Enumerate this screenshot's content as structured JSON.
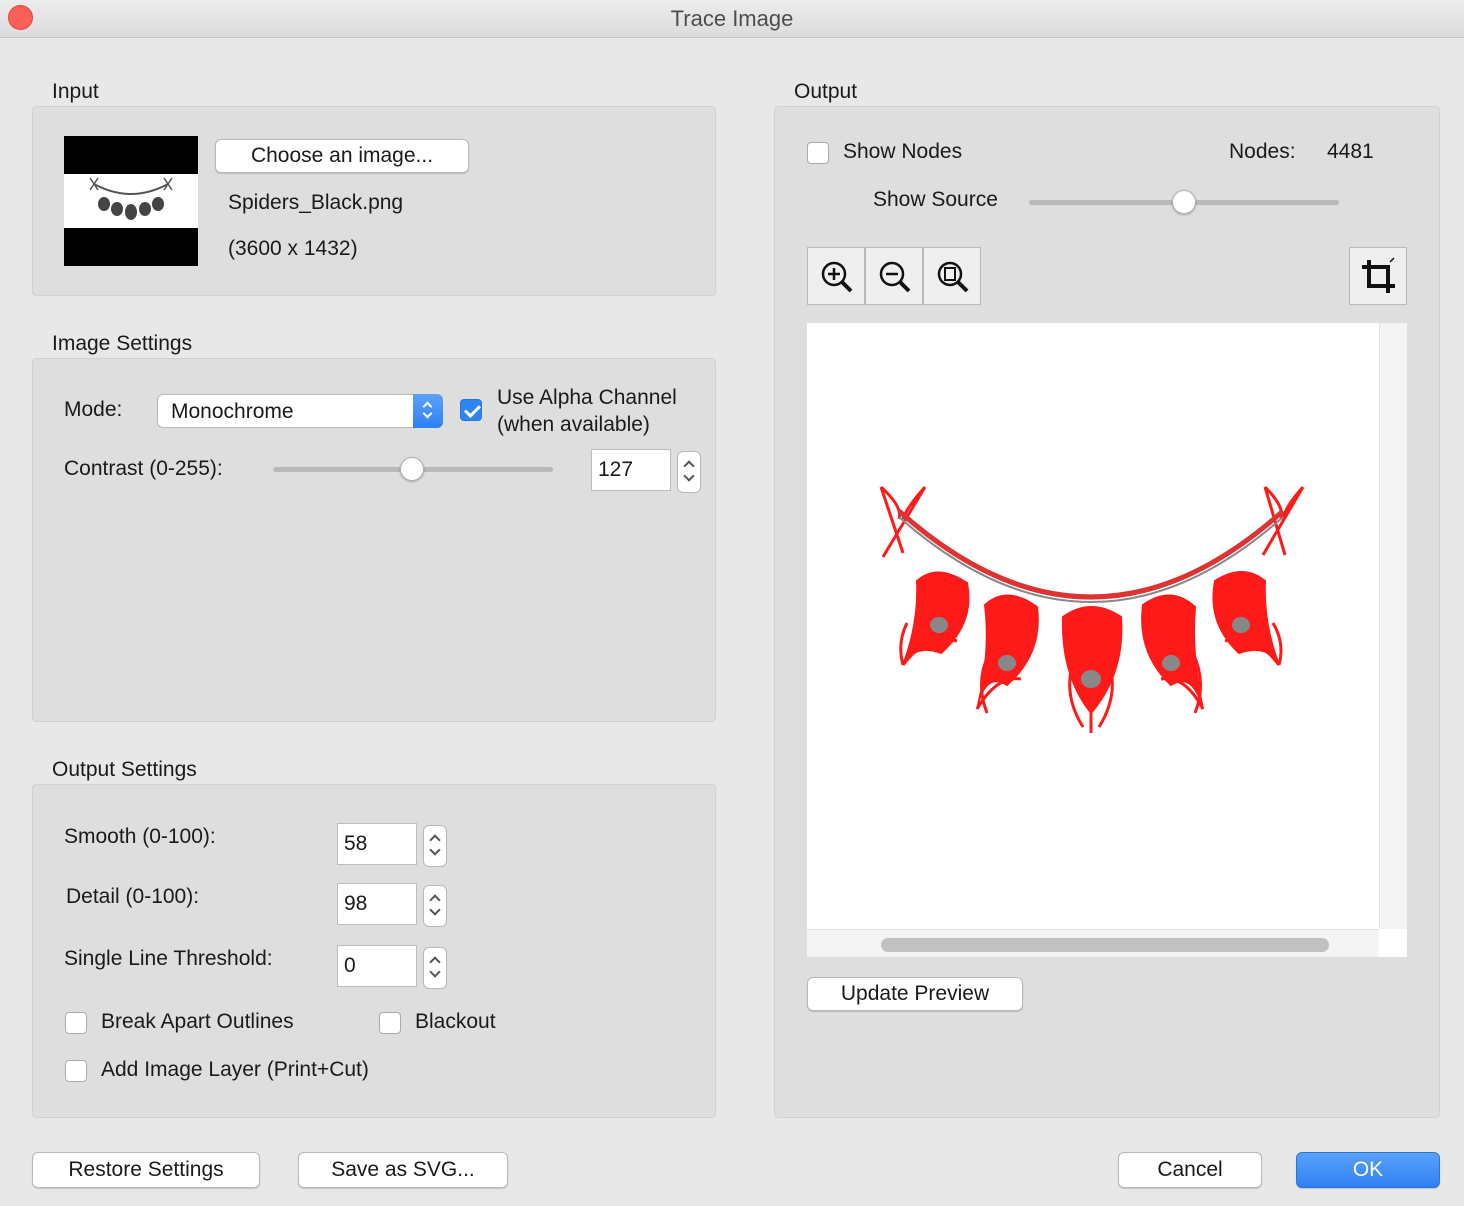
{
  "window": {
    "title": "Trace Image"
  },
  "input": {
    "section_label": "Input",
    "choose_button": "Choose an image...",
    "file_name": "Spiders_Black.png",
    "dimensions": "(3600 x 1432)"
  },
  "image_settings": {
    "section_label": "Image Settings",
    "mode_label": "Mode:",
    "mode_value": "Monochrome",
    "use_alpha_label_line1": "Use Alpha Channel",
    "use_alpha_label_line2": "(when available)",
    "use_alpha_checked": true,
    "contrast_label": "Contrast (0-255):",
    "contrast_value": "127",
    "contrast_slider": {
      "value": 127,
      "min": 0,
      "max": 255
    }
  },
  "output_settings": {
    "section_label": "Output Settings",
    "smooth_label": "Smooth (0-100):",
    "smooth_value": "58",
    "detail_label": "Detail (0-100):",
    "detail_value": "98",
    "single_line_label": "Single Line Threshold:",
    "single_line_value": "0",
    "break_apart_label": "Break Apart Outlines",
    "break_apart_checked": false,
    "blackout_label": "Blackout",
    "blackout_checked": false,
    "add_image_layer_label": "Add Image Layer (Print+Cut)",
    "add_image_layer_checked": false
  },
  "output": {
    "section_label": "Output",
    "show_nodes_label": "Show Nodes",
    "show_nodes_checked": false,
    "nodes_label": "Nodes:",
    "nodes_value": "4481",
    "show_source_label": "Show Source",
    "show_source_slider": {
      "value": 0.5
    },
    "toolbar_icons": [
      "zoom-in-icon",
      "zoom-out-icon",
      "zoom-fit-icon",
      "crop-icon"
    ],
    "update_preview_button": "Update Preview"
  },
  "footer": {
    "restore_button": "Restore Settings",
    "save_svg_button": "Save as SVG...",
    "cancel_button": "Cancel",
    "ok_button": "OK"
  },
  "colors": {
    "accent": "#2f84f3",
    "trace_red": "#ff1a1a",
    "close_red": "#fc5f57"
  }
}
